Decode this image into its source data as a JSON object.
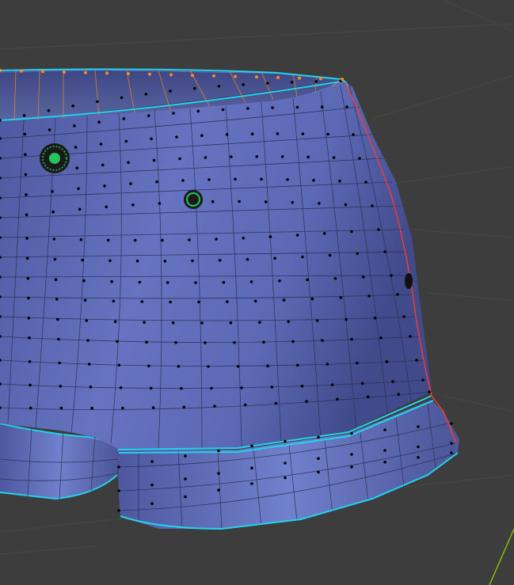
{
  "viewport": {
    "mode": "edit-mode-mesh",
    "object": "shorts-mesh",
    "colors": {
      "background": "#3d3d3d",
      "grid_line": "#4a4a4a",
      "mesh_face": "#5b66b0",
      "mesh_face_light": "#6f7dc8",
      "mesh_face_dark": "#414a8a",
      "wire": "#2a2f55",
      "vertex": "#000000",
      "seam": "#22d3ee",
      "sharp_edge": "#ff3a2a",
      "selected_edge": "#ff8c1a",
      "pin": "#22c55e",
      "axis_y": "#8ab800"
    }
  }
}
